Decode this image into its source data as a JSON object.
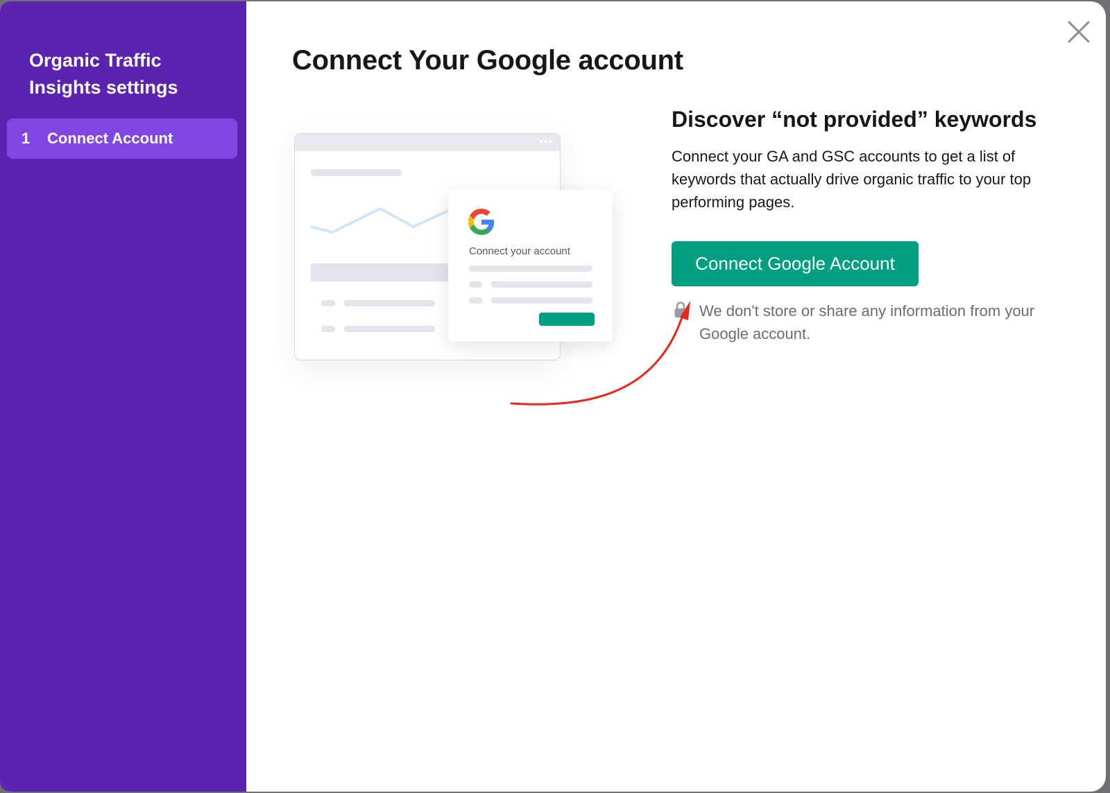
{
  "sidebar": {
    "title": "Organic Traffic Insights settings",
    "steps": [
      {
        "number": "1",
        "label": "Connect Account"
      }
    ]
  },
  "main": {
    "title": "Connect Your Google account",
    "illustration": {
      "card_text": "Connect your account",
      "dots": "•••"
    },
    "section_title": "Discover “not provided” keywords",
    "description": "Connect your GA and GSC accounts to get a list of keywords that actually drive organic traffic to your top performing pages.",
    "connect_button_label": "Connect Google Account",
    "privacy_note": "We don't store or share any information from your Google account."
  },
  "icons": {
    "close": "close-icon",
    "lock": "lock-icon",
    "google": "google-logo-icon"
  },
  "colors": {
    "sidebar": "#5a24b0",
    "active_step": "#8046e3",
    "primary_button": "#009f81",
    "annotation_arrow": "#e8261c"
  }
}
